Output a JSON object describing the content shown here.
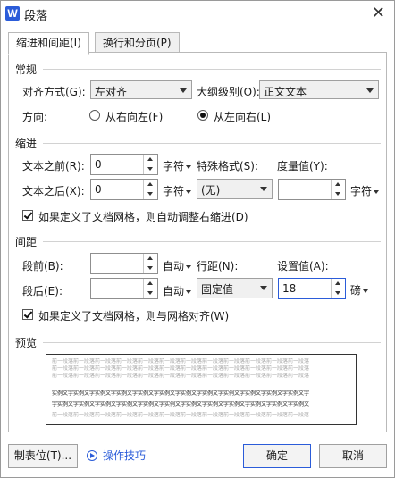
{
  "window": {
    "app_icon": "W",
    "title": "段落"
  },
  "tabs": [
    {
      "label": "缩进和间距(I)",
      "active": true
    },
    {
      "label": "换行和分页(P)",
      "active": false
    }
  ],
  "general": {
    "title": "常规",
    "align_label": "对齐方式(G):",
    "align_value": "左对齐",
    "outline_label": "大纲级别(O):",
    "outline_value": "正文文本",
    "direction_label": "方向:",
    "rtl_label": "从右向左(F)",
    "ltr_label": "从左向右(L)",
    "direction_selected": "ltr"
  },
  "indent": {
    "title": "缩进",
    "before_label": "文本之前(R):",
    "before_value": "0",
    "before_unit": "字符",
    "after_label": "文本之后(X):",
    "after_value": "0",
    "after_unit": "字符",
    "special_label": "特殊格式(S):",
    "special_value": "(无)",
    "measure_label": "度量值(Y):",
    "measure_value": "",
    "measure_unit": "字符",
    "grid_check_label": "如果定义了文档网格，则自动调整右缩进(D)",
    "grid_checked": true
  },
  "spacing": {
    "title": "间距",
    "before_label": "段前(B):",
    "before_value": "",
    "before_unit": "自动",
    "after_label": "段后(E):",
    "after_value": "",
    "after_unit": "自动",
    "line_label": "行距(N):",
    "line_value": "固定值",
    "set_label": "设置值(A):",
    "set_value": "18",
    "set_unit": "磅",
    "grid_check_label": "如果定义了文档网格，则与网格对齐(W)",
    "grid_checked": true
  },
  "preview": {
    "title": "预览",
    "prev_para": "前一段落前一段落前一段落前一段落前一段落前一段落前一段落前一段落前一段落前一段落前一段落前一段落",
    "sample_1": "实例文字实例文字实例文字实例文字实例文字实例文字实例文字实例文字实例文字实例文字实例文字实例文字",
    "sample_2": "字实例文字实例文字实例文字实例文字实例文字实例文字实例文字实例文字实例文字实例文字实例文字实例文"
  },
  "footer": {
    "tabs_button": "制表位(T)...",
    "tips_label": "操作技巧",
    "ok_button": "确定",
    "cancel_button": "取消"
  },
  "colors": {
    "accent": "#2b5cd9"
  }
}
